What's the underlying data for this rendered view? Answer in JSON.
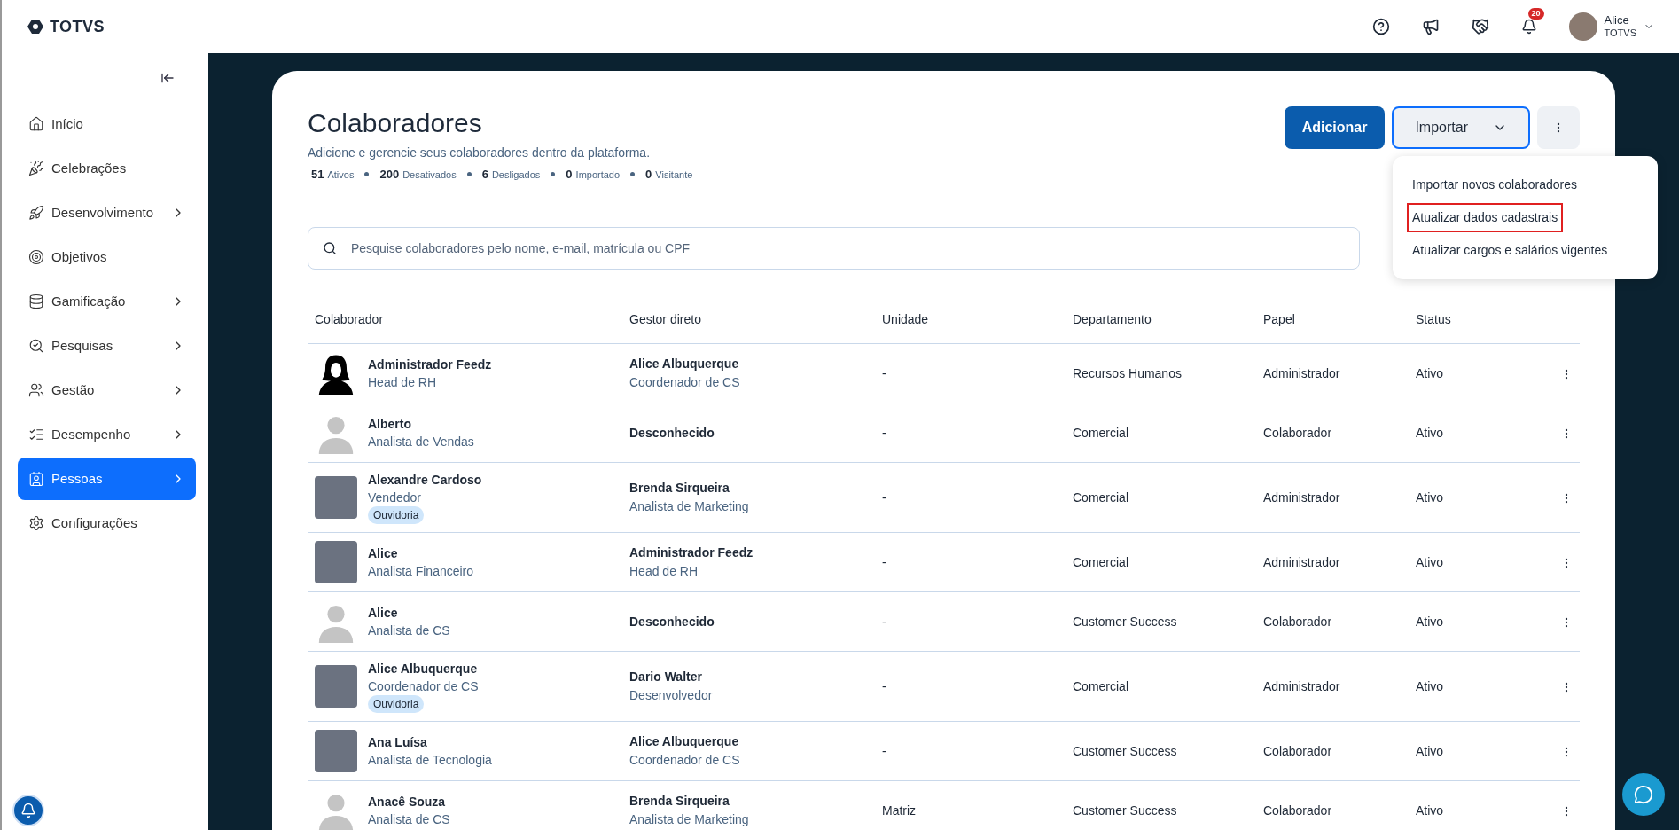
{
  "topbar": {
    "logo": "TOTVS",
    "notifications": "20",
    "user": {
      "name": "Alice",
      "company": "TOTVS"
    }
  },
  "sidebar": {
    "items": [
      {
        "label": "Início",
        "expandable": false,
        "selected": false
      },
      {
        "label": "Celebrações",
        "expandable": false,
        "selected": false
      },
      {
        "label": "Desenvolvimento",
        "expandable": true,
        "selected": false
      },
      {
        "label": "Objetivos",
        "expandable": false,
        "selected": false
      },
      {
        "label": "Gamificação",
        "expandable": true,
        "selected": false
      },
      {
        "label": "Pesquisas",
        "expandable": true,
        "selected": false
      },
      {
        "label": "Gestão",
        "expandable": true,
        "selected": false
      },
      {
        "label": "Desempenho",
        "expandable": true,
        "selected": false
      },
      {
        "label": "Pessoas",
        "expandable": true,
        "selected": true
      },
      {
        "label": "Configurações",
        "expandable": false,
        "selected": false
      }
    ]
  },
  "page": {
    "title": "Colaboradores",
    "subtitle": "Adicione e gerencie seus colaboradores dentro da plataforma.",
    "counts": [
      {
        "value": "51",
        "label": "Ativos"
      },
      {
        "value": "200",
        "label": "Desativados"
      },
      {
        "value": "6",
        "label": "Desligados"
      },
      {
        "value": "0",
        "label": "Importado"
      },
      {
        "value": "0",
        "label": "Visitante"
      }
    ],
    "add_button": "Adicionar",
    "import_button": "Importar",
    "import_menu": [
      {
        "label": "Importar novos colaboradores",
        "highlighted": false
      },
      {
        "label": "Atualizar dados cadastrais",
        "highlighted": true
      },
      {
        "label": "Atualizar cargos e salários vigentes",
        "highlighted": false
      }
    ],
    "search": {
      "placeholder": "Pesquise colaboradores pelo nome, e-mail, matrícula ou CPF"
    }
  },
  "table": {
    "columns": [
      "Colaborador",
      "Gestor direto",
      "Unidade",
      "Departamento",
      "Papel",
      "Status"
    ],
    "rows": [
      {
        "kind": "silhouette",
        "name": "Administrador Feedz",
        "role": "Head de RH",
        "manager": "Alice Albuquerque",
        "manager_role": "Coordenador de CS",
        "unit": "-",
        "department": "Recursos Humanos",
        "papel": "Administrador",
        "status": "Ativo"
      },
      {
        "kind": "default",
        "name": "Alberto",
        "role": "Analista de Vendas",
        "manager": "Desconhecido",
        "unit": "-",
        "department": "Comercial",
        "papel": "Colaborador",
        "status": "Ativo"
      },
      {
        "kind": "photo",
        "name": "Alexandre Cardoso",
        "role": "Vendedor",
        "tag": "Ouvidoria",
        "manager": "Brenda Sirqueira",
        "manager_role": "Analista de Marketing",
        "unit": "-",
        "department": "Comercial",
        "papel": "Administrador",
        "status": "Ativo"
      },
      {
        "kind": "photo",
        "name": "Alice",
        "role": "Analista Financeiro",
        "manager": "Administrador Feedz",
        "manager_role": "Head de RH",
        "unit": "-",
        "department": "Comercial",
        "papel": "Administrador",
        "status": "Ativo"
      },
      {
        "kind": "default",
        "name": "Alice",
        "role": "Analista de CS",
        "manager": "Desconhecido",
        "unit": "-",
        "department": "Customer Success",
        "papel": "Colaborador",
        "status": "Ativo"
      },
      {
        "kind": "photo",
        "name": "Alice Albuquerque",
        "role": "Coordenador de CS",
        "tag": "Ouvidoria",
        "manager": "Dario Walter",
        "manager_role": "Desenvolvedor",
        "unit": "-",
        "department": "Comercial",
        "papel": "Administrador",
        "status": "Ativo"
      },
      {
        "kind": "photo",
        "name": "Ana Luísa",
        "role": "Analista de Tecnologia",
        "manager": "Alice Albuquerque",
        "manager_role": "Coordenador de CS",
        "unit": "-",
        "department": "Customer Success",
        "papel": "Colaborador",
        "status": "Ativo"
      },
      {
        "kind": "default",
        "name": "Anacê Souza",
        "role": "Analista de CS",
        "manager": "Brenda Sirqueira",
        "manager_role": "Analista de Marketing",
        "unit": "Matriz",
        "department": "Customer Success",
        "papel": "Colaborador",
        "status": "Ativo"
      }
    ]
  }
}
